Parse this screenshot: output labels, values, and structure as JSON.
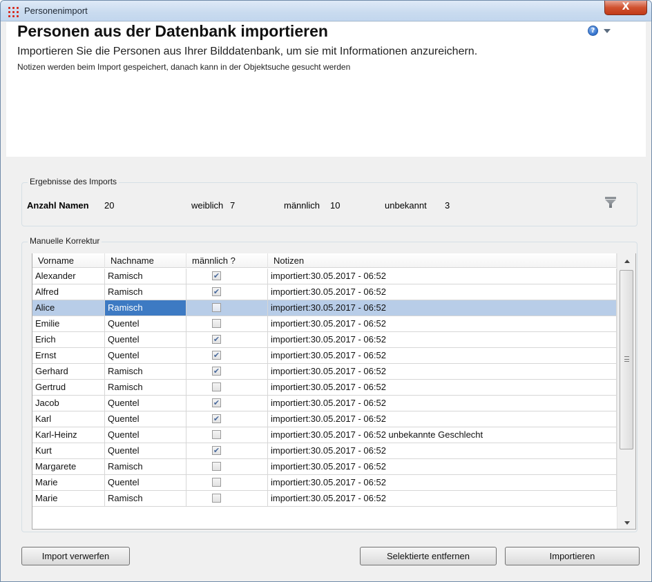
{
  "window": {
    "title": "Personenimport",
    "close_label": "X"
  },
  "header": {
    "heading": "Personen aus der Datenbank importieren",
    "subtitle": "Importieren Sie die Personen aus Ihrer Bilddatenbank, um sie mit Informationen anzureichern.",
    "note": "Notizen werden beim Import gespeichert, danach kann in der Objektsuche gesucht werden",
    "help_glyph": "?"
  },
  "stats": {
    "legend": "Ergebnisse des Imports",
    "total_label": "Anzahl Namen",
    "total_value": "20",
    "female_label": "weiblich",
    "female_value": "7",
    "male_label": "männlich",
    "male_value": "10",
    "unknown_label": "unbekannt",
    "unknown_value": "3"
  },
  "correction": {
    "legend": "Manuelle Korrektur",
    "columns": [
      "Vorname",
      "Nachname",
      "männlich ?",
      "Notizen"
    ],
    "selected_row": 2,
    "rows": [
      {
        "first": "Alexander",
        "last": "Ramisch",
        "male": true,
        "notes": "importiert:30.05.2017 - 06:52"
      },
      {
        "first": "Alfred",
        "last": "Ramisch",
        "male": true,
        "notes": "importiert:30.05.2017 - 06:52"
      },
      {
        "first": "Alice",
        "last": "Ramisch",
        "male": false,
        "notes": "importiert:30.05.2017 - 06:52"
      },
      {
        "first": "Emilie",
        "last": "Quentel",
        "male": false,
        "notes": "importiert:30.05.2017 - 06:52"
      },
      {
        "first": "Erich",
        "last": "Quentel",
        "male": true,
        "notes": "importiert:30.05.2017 - 06:52"
      },
      {
        "first": "Ernst",
        "last": "Quentel",
        "male": true,
        "notes": "importiert:30.05.2017 - 06:52"
      },
      {
        "first": "Gerhard",
        "last": "Ramisch",
        "male": true,
        "notes": "importiert:30.05.2017 - 06:52"
      },
      {
        "first": "Gertrud",
        "last": "Ramisch",
        "male": false,
        "notes": "importiert:30.05.2017 - 06:52"
      },
      {
        "first": "Jacob",
        "last": "Quentel",
        "male": true,
        "notes": "importiert:30.05.2017 - 06:52"
      },
      {
        "first": "Karl",
        "last": "Quentel",
        "male": true,
        "notes": "importiert:30.05.2017 - 06:52"
      },
      {
        "first": "Karl-Heinz",
        "last": "Quentel",
        "male": false,
        "notes": "importiert:30.05.2017 - 06:52 unbekannte Geschlecht"
      },
      {
        "first": "Kurt",
        "last": "Quentel",
        "male": true,
        "notes": "importiert:30.05.2017 - 06:52"
      },
      {
        "first": "Margarete",
        "last": "Ramisch",
        "male": false,
        "notes": "importiert:30.05.2017 - 06:52"
      },
      {
        "first": "Marie",
        "last": "Quentel",
        "male": false,
        "notes": "importiert:30.05.2017 - 06:52"
      },
      {
        "first": "Marie",
        "last": "Ramisch",
        "male": false,
        "notes": "importiert:30.05.2017 - 06:52"
      }
    ]
  },
  "buttons": {
    "discard": "Import verwerfen",
    "remove_selected": "Selektierte entfernen",
    "import": "Importieren"
  },
  "icons": {
    "app": "grid-dots-icon",
    "help": "help-icon",
    "filter": "filter-icon"
  },
  "colors": {
    "selection": "#b8cde8",
    "focus_cell": "#3d7ac3",
    "app_icon": "#d6261a"
  }
}
